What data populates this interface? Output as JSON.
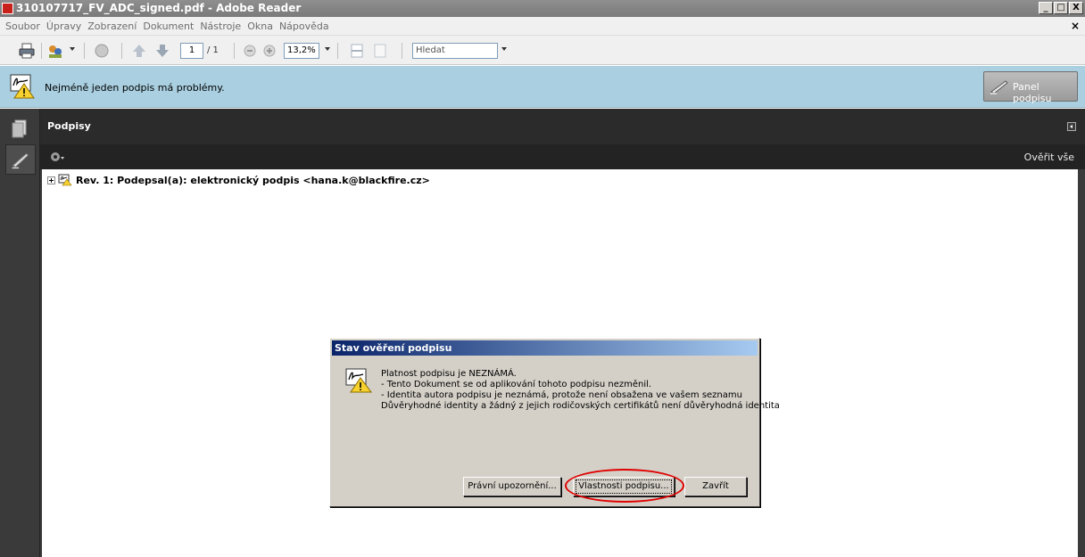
{
  "window": {
    "title": "310107717_FV_ADC_signed.pdf - Adobe Reader",
    "controls": [
      "_",
      "□",
      "X"
    ]
  },
  "menu": {
    "items": [
      "Soubor",
      "Úpravy",
      "Zobrazení",
      "Dokument",
      "Nástroje",
      "Okna",
      "Nápověda"
    ],
    "close_glyph": "×"
  },
  "toolbar": {
    "page_current": "1",
    "page_total": "/ 1",
    "zoom": "13,2%",
    "search_placeholder": "Hledat"
  },
  "message_bar": {
    "text": "Nejméně jeden podpis má problémy.",
    "panel_button": "Panel podpisu"
  },
  "signature_panel": {
    "title": "Podpisy",
    "verify_all": "Ověřit vše",
    "tree_item": "Rev. 1: Podepsal(a): elektronický podpis <hana.k@blackfire.cz>"
  },
  "dialog": {
    "title": "Stav ověření podpisu",
    "lines": [
      "Platnost podpisu je NEZNÁMÁ.",
      "- Tento Dokument se od aplikování tohoto podpisu nezměnil.",
      "- Identita autora podpisu je neznámá, protože není obsažena ve vašem seznamu",
      "Důvěryhodné identity a žádný z jejich rodičovských certifikátů není důvěryhodná identita"
    ],
    "buttons": {
      "legal": "Právní upozornění...",
      "properties": "Vlastnosti podpisu...",
      "close": "Zavřít"
    }
  },
  "colors": {
    "message_bar": "#a9cfe0",
    "annotation_ellipse": "#e00000",
    "dialog_title_start": "#0a246a"
  }
}
